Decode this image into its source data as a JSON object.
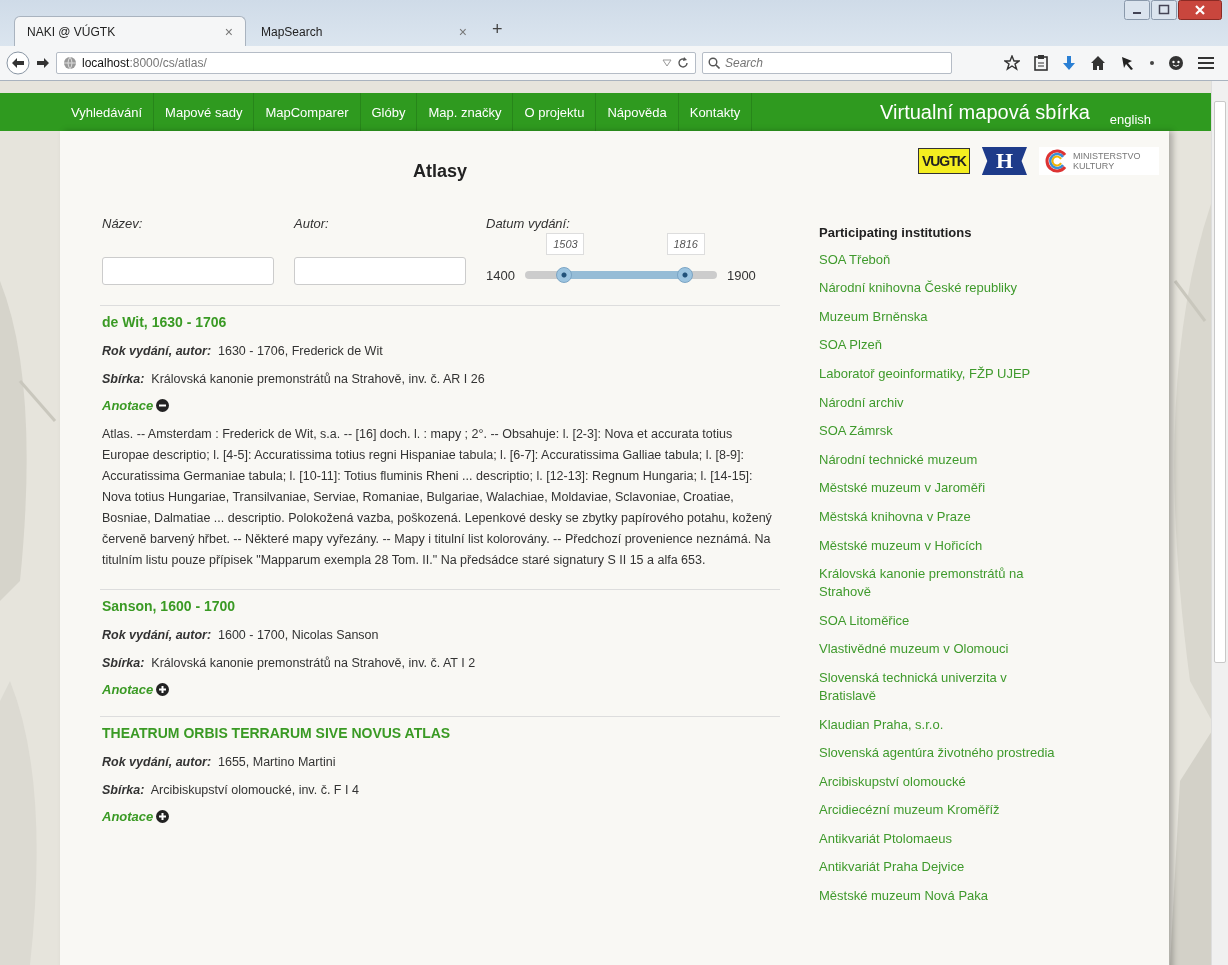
{
  "browser": {
    "tabs": [
      {
        "title": "NAKI @ VÚGTK",
        "close": "×",
        "selected": true
      },
      {
        "title": "MapSearch",
        "close": "×",
        "selected": false
      }
    ],
    "new_tab": "+",
    "address": {
      "host": "localhost",
      "path": ":8000/cs/atlas/"
    },
    "search": {
      "placeholder": "Search"
    }
  },
  "nav": {
    "items": [
      {
        "label": "Vyhledávání"
      },
      {
        "label": "Mapové sady"
      },
      {
        "label": "MapComparer"
      },
      {
        "label": "Glóby"
      },
      {
        "label": "Map. značky"
      },
      {
        "label": "O projektu"
      },
      {
        "label": "Nápověda"
      },
      {
        "label": "Kontakty"
      }
    ],
    "site_title": "Virtualní mapová sbírka",
    "language": "english"
  },
  "heading": "Atlasy",
  "filters": {
    "name_label": "Název:",
    "author_label": "Autor:",
    "date_label": "Datum vydání:",
    "slider": {
      "min": "1400",
      "max": "1900",
      "from": {
        "reading": "1503",
        "level": 0.206
      },
      "to": {
        "reading": "1816",
        "level": 0.832
      }
    }
  },
  "records": [
    {
      "title": "de Wit, 1630 - 1706",
      "year_label": "Rok vydání, autor:",
      "year_value": "1630 - 1706, Frederick de Wit",
      "collection_label": "Sbírka:",
      "collection_value": "Královská kanonie premonstrátů na Strahově, inv. č. AR I 26",
      "annotation_label": "Anotace",
      "expanded": true,
      "annotation": "Atlas. -- Amsterdam : Frederick de Wit, s.a. -- [16] doch. l. : mapy ; 2°. -- Obsahuje: l. [2-3]: Nova et accurata totius Europae descriptio; l. [4-5]: Accuratissima totius regni Hispaniae tabula; l. [6-7]: Accuratissima Galliae tabula; l. [8-9]: Accuratissima Germaniae tabula; l. [10-11]: Totius fluminis Rheni ... descriptio; l. [12-13]: Regnum Hungaria; l. [14-15]: Nova totius Hungariae, Transilvaniae, Serviae, Romaniae, Bulgariae, Walachiae, Moldaviae, Sclavoniae, Croatiae, Bosniae, Dalmatiae ... descriptio. Polokožená vazba, poškozená. Lepenkové desky se zbytky papírového potahu, kožený červeně barvený hřbet. -- Některé mapy vyřezány. -- Mapy i titulní list kolorovány. -- Předchozí provenience neznámá. Na titulním listu pouze přípisek \"Mapparum exempla 28 Tom. II.\" Na předsádce staré signatury S II 15 a alfa 653."
    },
    {
      "title": "Sanson, 1600 - 1700",
      "year_label": "Rok vydání, autor:",
      "year_value": "1600 - 1700, Nicolas Sanson",
      "collection_label": "Sbírka:",
      "collection_value": "Královská kanonie premonstrátů na Strahově, inv. č. AT I 2",
      "annotation_label": "Anotace",
      "expanded": false
    },
    {
      "title": "THEATRUM ORBIS TERRARUM SIVE NOVUS ATLAS",
      "year_label": "Rok vydání, autor:",
      "year_value": "1655, Martino Martini",
      "collection_label": "Sbírka:",
      "collection_value": "Arcibiskupství olomoucké, inv. č. F I 4",
      "annotation_label": "Anotace",
      "expanded": false
    }
  ],
  "logos": [
    {
      "kind": "vugtk",
      "text": "VUGTK"
    },
    {
      "kind": "h",
      "text": "H"
    },
    {
      "kind": "ministry",
      "text": "MINISTERSTVO KULTURY"
    }
  ],
  "sidebar": {
    "heading": "Participating institutions",
    "items": [
      "SOA Třeboň",
      "Národní knihovna České republiky",
      "Muzeum Brněnska",
      "SOA Plzeň",
      "Laboratoř geoinformatiky, FŽP UJEP",
      "Národní archiv",
      "SOA Zámrsk",
      "Národní technické muzeum",
      "Městské muzeum v Jaroměři",
      "Městská knihovna v Praze",
      "Městské muzeum v Hořicích",
      "Královská kanonie premonstrátů na Strahově",
      "SOA Litoměřice",
      "Vlastivědné muzeum v Olomouci",
      "Slovenská technická univerzita v Bratislavě",
      "Klaudian Praha, s.r.o.",
      "Slovenská agentúra životného prostredia",
      "Arcibiskupství olomoucké",
      "Arcidiecézní muzeum Kroměříž",
      "Antikvariát Ptolomaeus",
      "Antikvariát Praha Dejvice",
      "Městské muzeum Nová Paka"
    ]
  }
}
